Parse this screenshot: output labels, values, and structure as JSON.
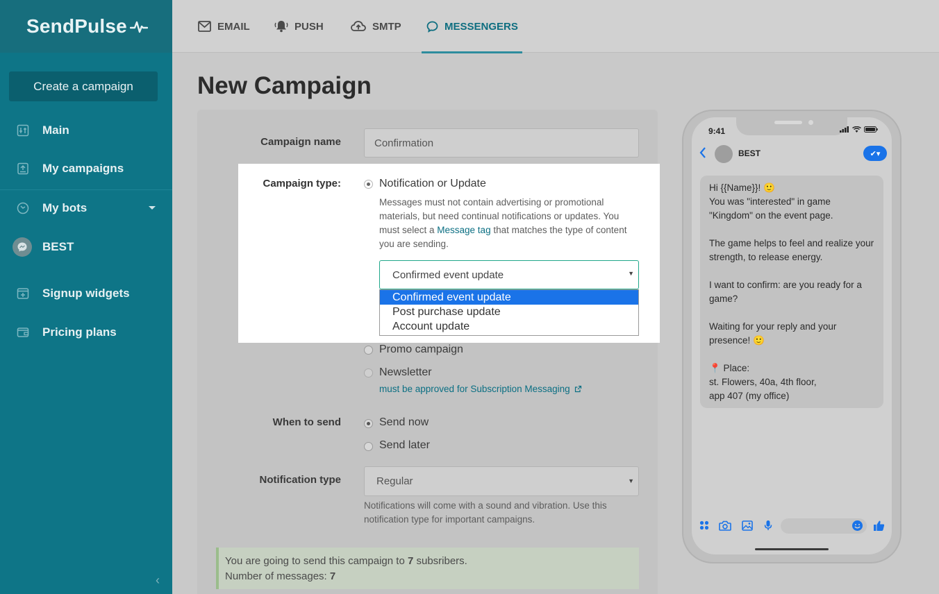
{
  "brand": {
    "name": "SendPulse"
  },
  "sidebar": {
    "create_label": "Create a campaign",
    "items": [
      {
        "label": "Main",
        "icon": "sliders-icon"
      },
      {
        "label": "My campaigns",
        "icon": "campaigns-icon"
      },
      {
        "label": "My bots",
        "icon": "bots-icon"
      },
      {
        "label": "BEST",
        "icon": "messenger-icon"
      },
      {
        "label": "Signup widgets",
        "icon": "widget-icon"
      },
      {
        "label": "Pricing plans",
        "icon": "wallet-icon"
      }
    ]
  },
  "tabs": [
    {
      "label": "EMAIL",
      "icon": "mail-icon",
      "active": false
    },
    {
      "label": "PUSH",
      "icon": "bell-icon",
      "active": false
    },
    {
      "label": "SMTP",
      "icon": "cloud-upload-icon",
      "active": false
    },
    {
      "label": "MESSENGERS",
      "icon": "chat-icon",
      "active": true
    }
  ],
  "page": {
    "title": "New Campaign"
  },
  "form": {
    "campaign_name": {
      "label": "Campaign name",
      "value": "Confirmation"
    },
    "campaign_type": {
      "label": "Campaign type:",
      "options": {
        "notification": "Notification or Update",
        "promo": "Promo campaign",
        "newsletter": "Newsletter"
      },
      "help_before": "Messages must not contain advertising or promotional materials, but need continual notifications or updates. You must select a ",
      "help_link": "Message tag",
      "help_after": " that matches the type of content you are sending.",
      "newsletter_note": "must be approved for Subscription Messaging",
      "tag_select": {
        "value": "Confirmed event update",
        "options": [
          "Confirmed event update",
          "Post purchase update",
          "Account update"
        ]
      }
    },
    "when_to_send": {
      "label": "When to send",
      "now": "Send now",
      "later": "Send later"
    },
    "notification_type": {
      "label": "Notification type",
      "value": "Regular",
      "help": "Notifications will come with a sound and vibration. Use this notification type for important campaigns."
    }
  },
  "summary": {
    "line1_before": "You are going to send this campaign to ",
    "subscribers": "7",
    "line1_after": " subsribers.",
    "line2_label": "Number of messages: ",
    "messages": "7"
  },
  "preview": {
    "time": "9:41",
    "chat_name": "BEST",
    "message_lines": [
      "Hi {{Name}}! 🙂",
      "You was \"interested\" in game \"Kingdom\" on the event page.",
      "",
      "The game helps to feel and realize your strength, to release energy.",
      "",
      "I want to confirm: are you ready for a game?",
      "",
      "Waiting for your reply and your presence! 🙂",
      "",
      "📍 Place:",
      "st. Flowers, 40a, 4th floor,",
      "app 407 (my office)"
    ]
  },
  "colors": {
    "sidebar": "#0e7587",
    "accent": "#0e6e80",
    "option_selected": "#1a73e8",
    "select_focus": "#20a78a",
    "messenger_blue": "#1a73e8"
  }
}
